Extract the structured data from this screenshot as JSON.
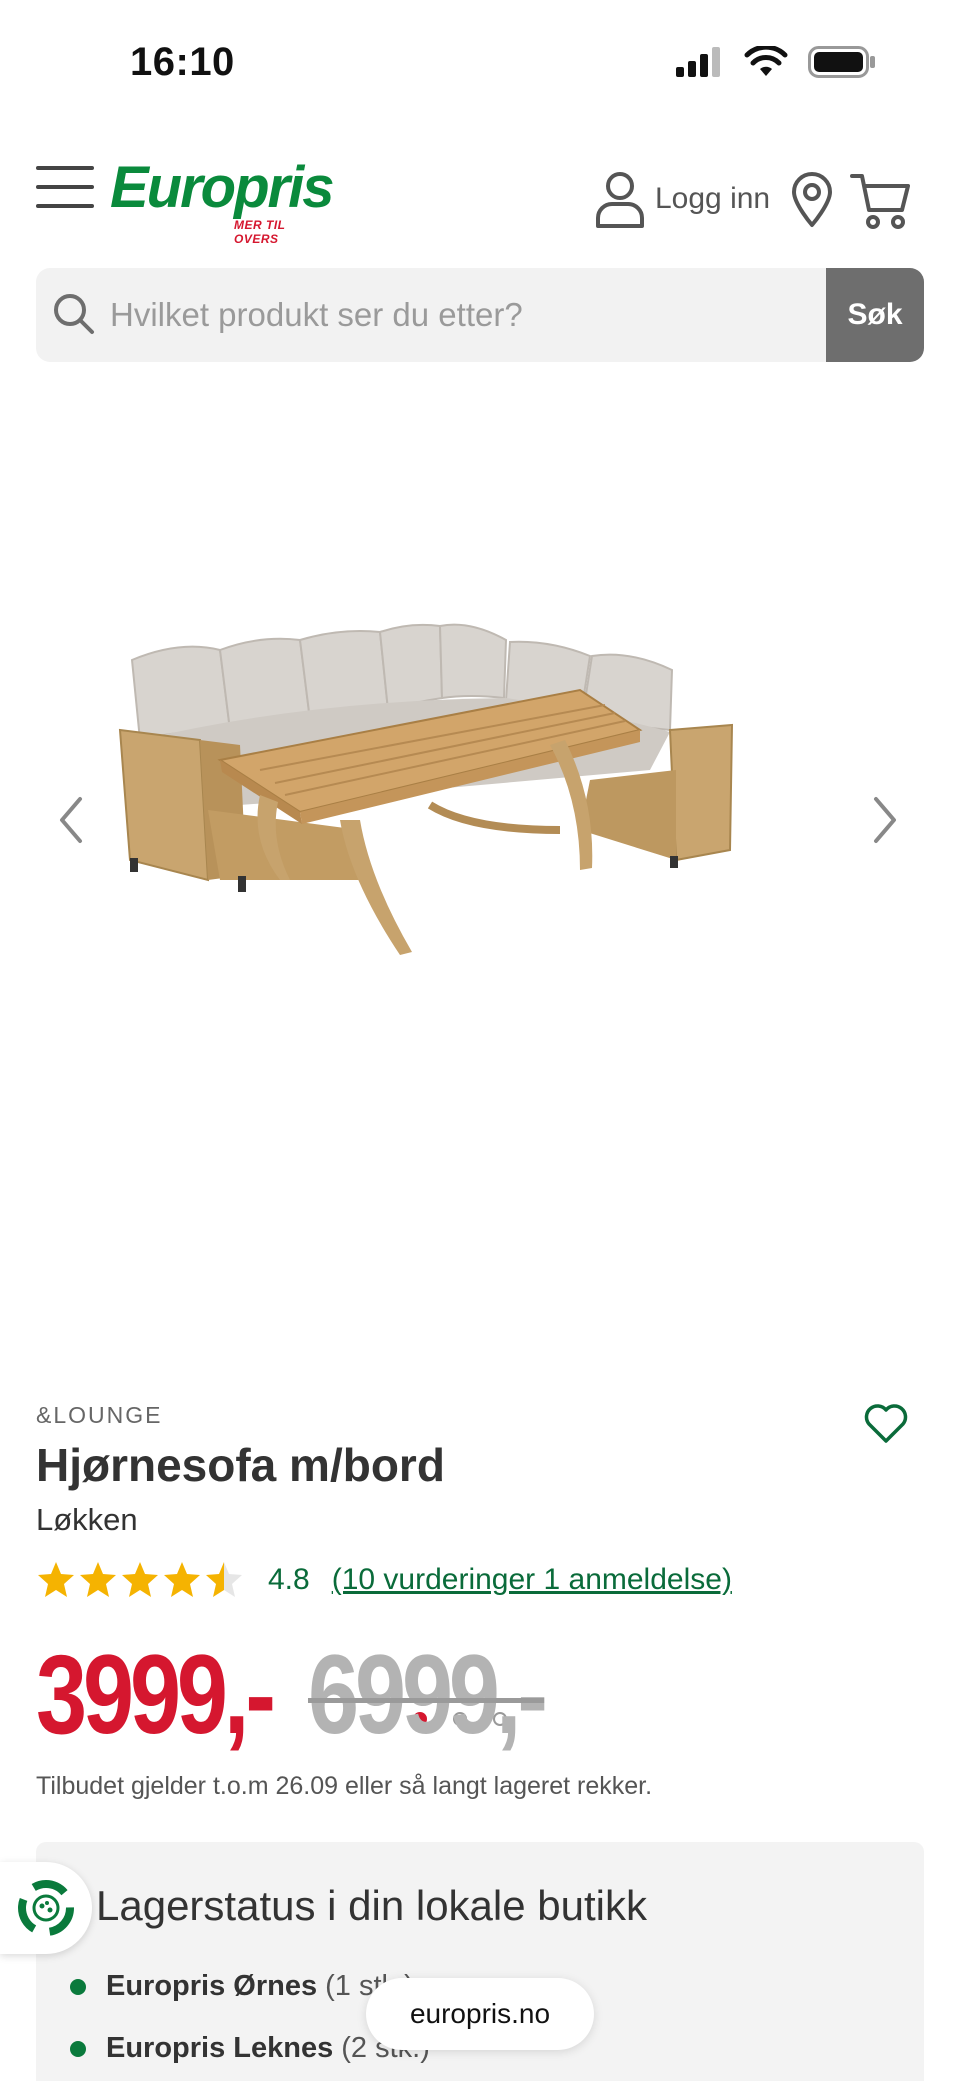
{
  "status_bar": {
    "time": "16:10",
    "icons": [
      "signal-icon",
      "wifi-icon",
      "battery-icon"
    ]
  },
  "header": {
    "menu_icon": "hamburger-menu-icon",
    "logo_text": "Europris",
    "logo_tagline": "MER TIL OVERS",
    "login_label": "Logg inn",
    "login_icon": "user-icon",
    "location_icon": "location-pin-icon",
    "cart_icon": "shopping-cart-icon"
  },
  "search": {
    "placeholder": "Hvilket produkt ser du etter?",
    "value": "",
    "button_label": "Søk"
  },
  "gallery": {
    "image_alt": "Hjørnesofa m/bord Løkken",
    "dot_count": 3,
    "active_index": 0
  },
  "product": {
    "brand": "&LOUNGE",
    "title": "Hjørnesofa m/bord",
    "subtitle": "Løkken",
    "rating_value": "4.8",
    "rating_stars": 4.5,
    "rating_link": "(10 vurderinger 1 anmeldelse)",
    "price_now": "3999,-",
    "price_old": "6999,-",
    "offer_note": "Tilbudet gjelder t.o.m 26.09 eller så langt lageret rekker."
  },
  "stock": {
    "title": "Lagerstatus i din lokale butikk",
    "stores": [
      {
        "name": "Europris Ørnes",
        "qty": "(1 stk.)"
      },
      {
        "name": "Europris Leknes",
        "qty": "(2 stk.)"
      }
    ]
  },
  "floating": {
    "url": "europris.no"
  },
  "colors": {
    "brand_green": "#0a8a3c",
    "brand_red": "#d5172f",
    "link_green": "#0a6b3a",
    "star_yellow": "#f5b301"
  }
}
